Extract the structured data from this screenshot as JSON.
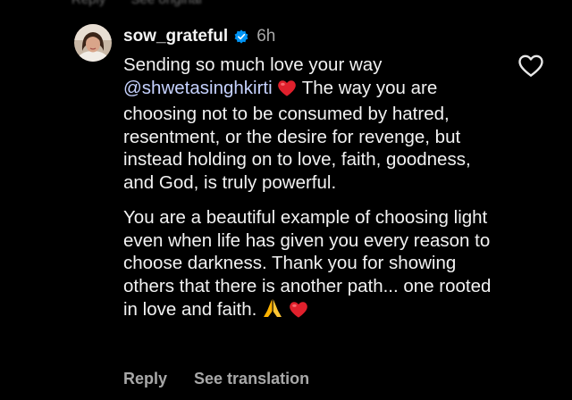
{
  "previous_comment": {
    "actions": [
      "Reply",
      "See original"
    ]
  },
  "comment": {
    "username": "sow_grateful",
    "verified": true,
    "timestamp": "6h",
    "body": {
      "p1_start": "Sending so much love your way",
      "mention": "@shwetasinghkirti",
      "p1_rest_line": "The way you",
      "p1_end": "are choosing not to be consumed by hatred, resentment, or the desire for revenge, but instead holding on to love, faith, goodness, and God, is truly powerful.",
      "p2": "You are a beautiful example of choosing light even when life has given you every reason to choose darkness. Thank you for showing others that there is another path... one rooted in love and faith."
    },
    "emoji": [
      "red-heart",
      "folded-hands",
      "red-heart"
    ],
    "actions": {
      "reply": "Reply",
      "see_translation": "See translation"
    }
  },
  "colors": {
    "background": "#000000",
    "text": "#f2f2f2",
    "secondary_text": "#a8a8a8",
    "mention": "#c6d2ff",
    "verified_badge": "#0095f6",
    "heart_emoji": "#e0202c"
  }
}
